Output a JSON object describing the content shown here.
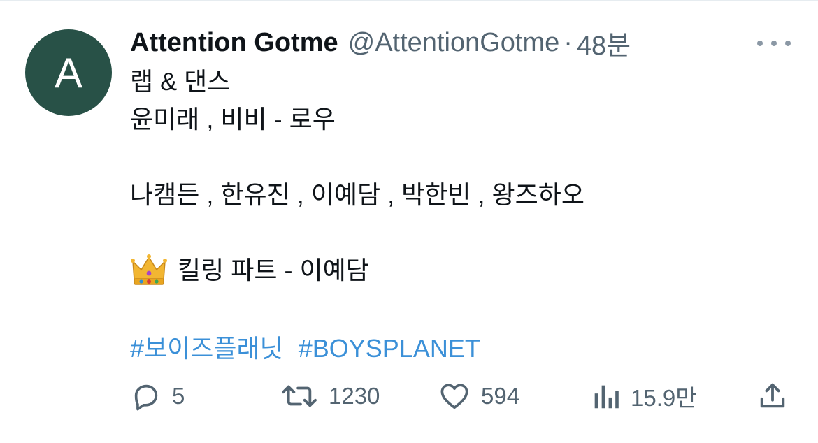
{
  "tweet": {
    "avatar_letter": "A",
    "display_name": "Attention Gotme",
    "handle": "@AttentionGotme",
    "separator": "·",
    "time": "48분",
    "lines": {
      "l1": "랩 & 댄스",
      "l2": "윤미래 , 비비 - 로우",
      "l3": "나캠든 , 한유진 , 이예담 , 박한빈 , 왕즈하오",
      "l4_text": "킬링 파트 - 이예담"
    },
    "hashtags": [
      "#보이즈플래닛",
      "#BOYSPLANET"
    ],
    "emoji": "crown-emoji"
  },
  "actions": {
    "replies": "5",
    "retweets": "1230",
    "likes": "594",
    "views": "15.9만"
  },
  "colors": {
    "avatar_bg": "#285147",
    "hashtag": "#3b90d8",
    "muted": "#536471",
    "text": "#0f1419"
  }
}
